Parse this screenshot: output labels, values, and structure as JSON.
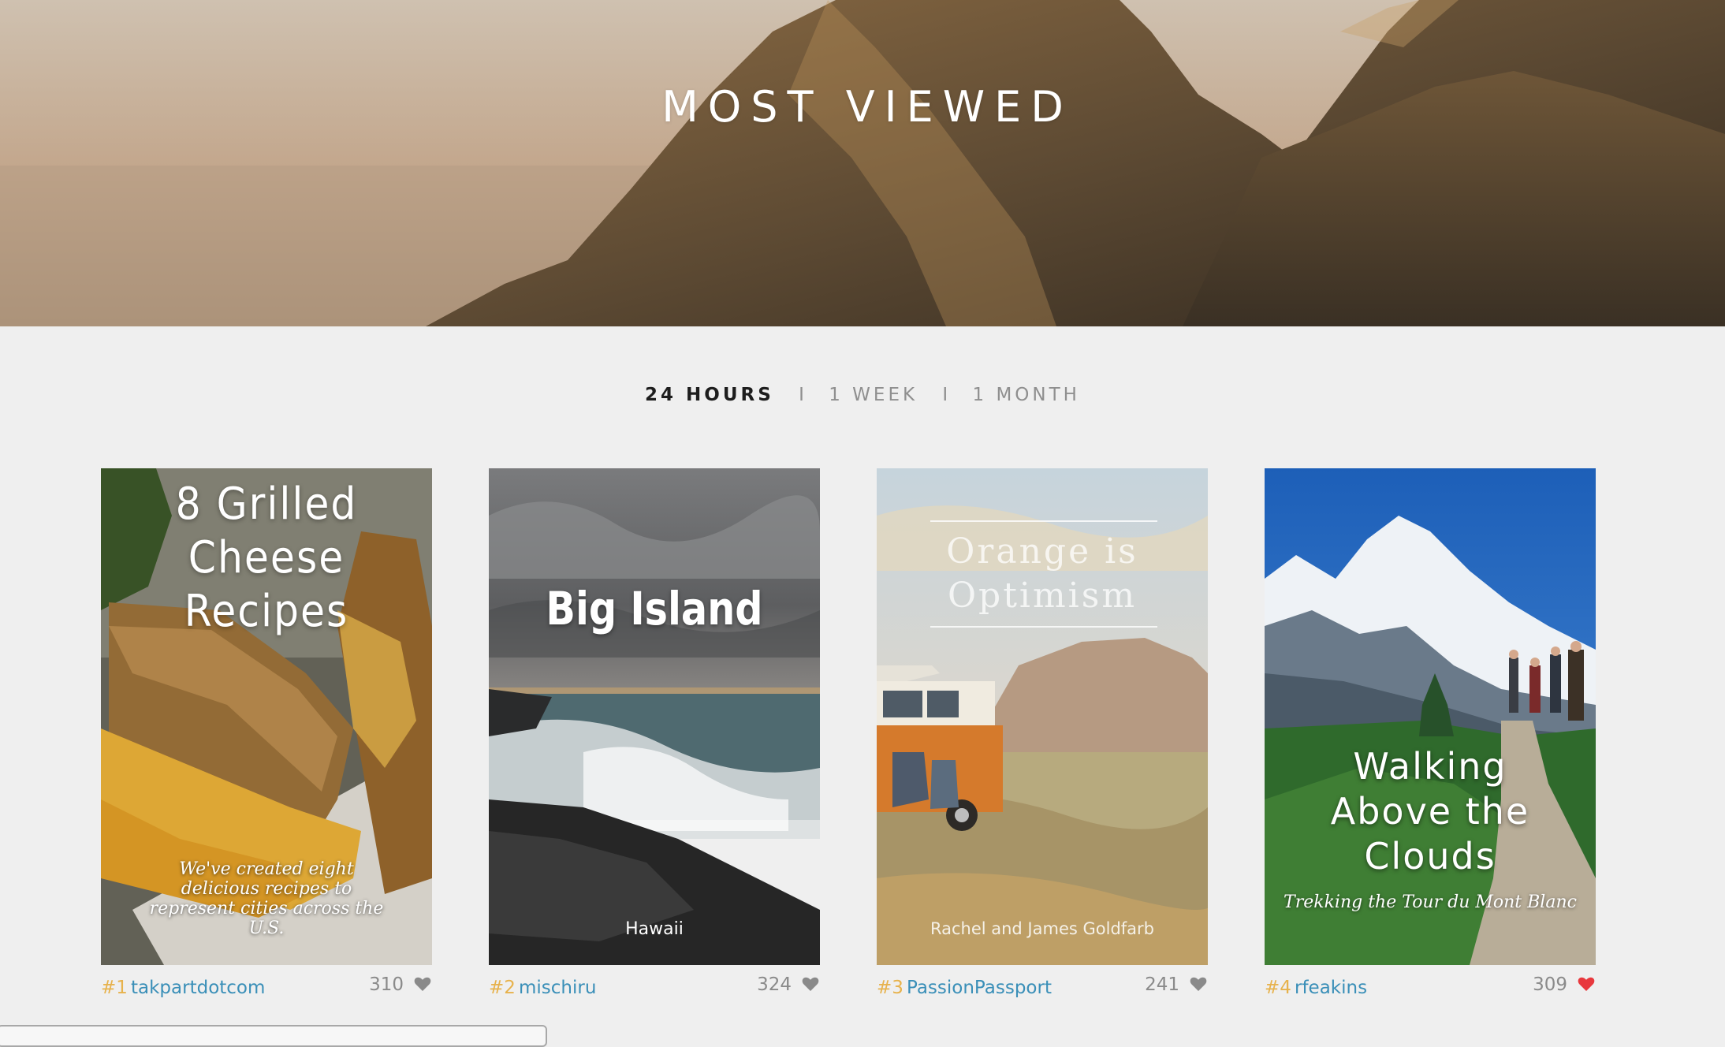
{
  "hero": {
    "title": "MOST VIEWED"
  },
  "tabs": [
    {
      "label": "24 HOURS",
      "active": true
    },
    {
      "label": "1 WEEK",
      "active": false
    },
    {
      "label": "1 MONTH",
      "active": false
    }
  ],
  "tab_separator": "I",
  "cards": [
    {
      "rank": "#1",
      "user": "takpartdotcom",
      "count": "310",
      "liked": false,
      "cover_title": "8 Grilled Cheese Recipes",
      "cover_title_lines": [
        "8 Grilled",
        "Cheese",
        "Recipes"
      ],
      "cover_subtitle": "We've created eight delicious recipes to represent cities across the U.S."
    },
    {
      "rank": "#2",
      "user": "mischiru",
      "count": "324",
      "liked": false,
      "cover_title": "Big Island",
      "cover_author": "Hawaii"
    },
    {
      "rank": "#3",
      "user": "PassionPassport",
      "count": "241",
      "liked": false,
      "cover_title_lines": [
        "Orange is",
        "Optimism"
      ],
      "cover_author": "Rachel and James Goldfarb"
    },
    {
      "rank": "#4",
      "user": "rfeakins",
      "count": "309",
      "liked": true,
      "cover_title_lines": [
        "Walking",
        "Above the",
        "Clouds"
      ],
      "cover_subtitle": "Trekking the Tour du Mont Blanc"
    }
  ],
  "colors": {
    "rank": "#e7b24c",
    "user_link": "#3a8fb8",
    "heart_default": "#8a8a8a",
    "heart_liked": "#e8383d"
  },
  "icons": {
    "heart": "heart-icon"
  }
}
